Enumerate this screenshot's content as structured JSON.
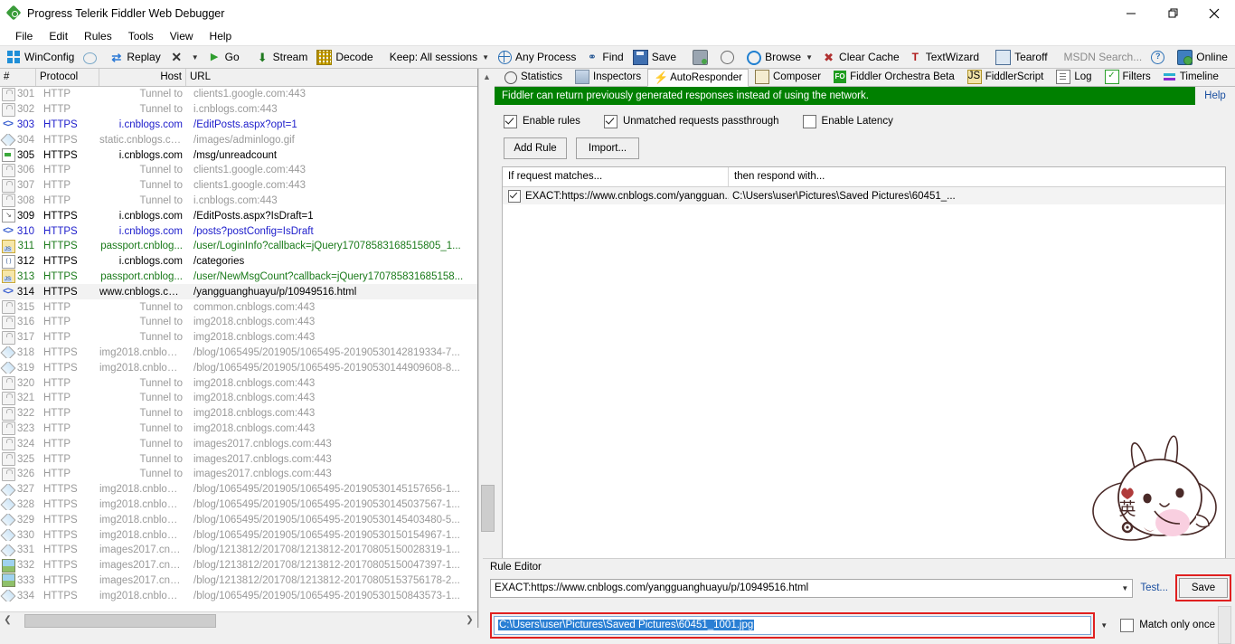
{
  "window": {
    "title": "Progress Telerik Fiddler Web Debugger",
    "minimize": "─",
    "maximize": "❐",
    "close": "✕"
  },
  "menu": [
    "File",
    "Edit",
    "Rules",
    "Tools",
    "View",
    "Help"
  ],
  "toolbar": [
    {
      "label": "WinConfig",
      "icon": "windows-icon"
    },
    {
      "label": "",
      "icon": "comment-bubble-icon"
    },
    {
      "label": "Replay",
      "icon": "replay-icon"
    },
    {
      "label": "",
      "icon": "remove-x-icon",
      "caret": true
    },
    {
      "label": "Go",
      "icon": "go-play-icon"
    },
    {
      "label": "Stream",
      "icon": "stream-icon"
    },
    {
      "label": "Decode",
      "icon": "decode-icon"
    },
    {
      "label": "Keep: All sessions",
      "icon": "",
      "caret": true
    },
    {
      "label": "Any Process",
      "icon": "target-icon"
    },
    {
      "label": "Find",
      "icon": "binoculars-icon"
    },
    {
      "label": "Save",
      "icon": "save-icon"
    },
    {
      "label": "",
      "icon": "screenshot-camera-icon"
    },
    {
      "label": "",
      "icon": "timer-clock-icon"
    },
    {
      "label": "Browse",
      "icon": "browser-icon",
      "caret": true
    },
    {
      "label": "Clear Cache",
      "icon": "clear-cache-icon"
    },
    {
      "label": "TextWizard",
      "icon": "textwizard-icon"
    },
    {
      "label": "Tearoff",
      "icon": "tearoff-icon"
    },
    {
      "label": "MSDN Search...",
      "icon": "",
      "dim": true
    },
    {
      "label": "",
      "icon": "help-circle-icon"
    },
    {
      "label": "Online",
      "icon": "online-globe-icon"
    }
  ],
  "toolbar_close": "✕",
  "sessions": {
    "columns": [
      "#",
      "Protocol",
      "Host",
      "URL"
    ],
    "rows": [
      {
        "icon": "lock-icon",
        "num": "301",
        "protocol": "HTTP",
        "host": "Tunnel to",
        "url": "clients1.google.com:443",
        "style": "gray"
      },
      {
        "icon": "lock-icon",
        "num": "302",
        "protocol": "HTTP",
        "host": "Tunnel to",
        "url": "i.cnblogs.com:443",
        "style": "gray"
      },
      {
        "icon": "code-icon",
        "num": "303",
        "protocol": "HTTPS",
        "host": "i.cnblogs.com",
        "url": "/EditPosts.aspx?opt=1",
        "style": "blue"
      },
      {
        "icon": "image-icon",
        "num": "304",
        "protocol": "HTTPS",
        "host": "static.cnblogs.com",
        "url": "/images/adminlogo.gif",
        "style": "gray"
      },
      {
        "icon": "arrow-icon",
        "num": "305",
        "protocol": "HTTPS",
        "host": "i.cnblogs.com",
        "url": "/msg/unreadcount",
        "style": "black"
      },
      {
        "icon": "lock-icon",
        "num": "306",
        "protocol": "HTTP",
        "host": "Tunnel to",
        "url": "clients1.google.com:443",
        "style": "gray"
      },
      {
        "icon": "lock-icon",
        "num": "307",
        "protocol": "HTTP",
        "host": "Tunnel to",
        "url": "clients1.google.com:443",
        "style": "gray"
      },
      {
        "icon": "lock-icon",
        "num": "308",
        "protocol": "HTTP",
        "host": "Tunnel to",
        "url": "i.cnblogs.com:443",
        "style": "gray"
      },
      {
        "icon": "download-icon",
        "num": "309",
        "protocol": "HTTPS",
        "host": "i.cnblogs.com",
        "url": "/EditPosts.aspx?IsDraft=1",
        "style": "black"
      },
      {
        "icon": "code-icon",
        "num": "310",
        "protocol": "HTTPS",
        "host": "i.cnblogs.com",
        "url": "/posts?postConfig=IsDraft",
        "style": "blue"
      },
      {
        "icon": "js-icon",
        "num": "311",
        "protocol": "HTTPS",
        "host": "passport.cnblog...",
        "url": "/user/LoginInfo?callback=jQuery17078583168515805_1...",
        "style": "green"
      },
      {
        "icon": "json-icon",
        "num": "312",
        "protocol": "HTTPS",
        "host": "i.cnblogs.com",
        "url": "/categories",
        "style": "black"
      },
      {
        "icon": "js-icon",
        "num": "313",
        "protocol": "HTTPS",
        "host": "passport.cnblog...",
        "url": "/user/NewMsgCount?callback=jQuery170785831685158...",
        "style": "green"
      },
      {
        "icon": "code-icon",
        "num": "314",
        "protocol": "HTTPS",
        "host": "www.cnblogs.com",
        "url": "/yangguanghuayu/p/10949516.html",
        "style": "black",
        "selected": true
      },
      {
        "icon": "lock-icon",
        "num": "315",
        "protocol": "HTTP",
        "host": "Tunnel to",
        "url": "common.cnblogs.com:443",
        "style": "gray"
      },
      {
        "icon": "lock-icon",
        "num": "316",
        "protocol": "HTTP",
        "host": "Tunnel to",
        "url": "img2018.cnblogs.com:443",
        "style": "gray"
      },
      {
        "icon": "lock-icon",
        "num": "317",
        "protocol": "HTTP",
        "host": "Tunnel to",
        "url": "img2018.cnblogs.com:443",
        "style": "gray"
      },
      {
        "icon": "image-icon",
        "num": "318",
        "protocol": "HTTPS",
        "host": "img2018.cnblogs...",
        "url": "/blog/1065495/201905/1065495-20190530142819334-7...",
        "style": "gray"
      },
      {
        "icon": "image-icon",
        "num": "319",
        "protocol": "HTTPS",
        "host": "img2018.cnblogs...",
        "url": "/blog/1065495/201905/1065495-20190530144909608-8...",
        "style": "gray"
      },
      {
        "icon": "lock-icon",
        "num": "320",
        "protocol": "HTTP",
        "host": "Tunnel to",
        "url": "img2018.cnblogs.com:443",
        "style": "gray"
      },
      {
        "icon": "lock-icon",
        "num": "321",
        "protocol": "HTTP",
        "host": "Tunnel to",
        "url": "img2018.cnblogs.com:443",
        "style": "gray"
      },
      {
        "icon": "lock-icon",
        "num": "322",
        "protocol": "HTTP",
        "host": "Tunnel to",
        "url": "img2018.cnblogs.com:443",
        "style": "gray"
      },
      {
        "icon": "lock-icon",
        "num": "323",
        "protocol": "HTTP",
        "host": "Tunnel to",
        "url": "img2018.cnblogs.com:443",
        "style": "gray"
      },
      {
        "icon": "lock-icon",
        "num": "324",
        "protocol": "HTTP",
        "host": "Tunnel to",
        "url": "images2017.cnblogs.com:443",
        "style": "gray"
      },
      {
        "icon": "lock-icon",
        "num": "325",
        "protocol": "HTTP",
        "host": "Tunnel to",
        "url": "images2017.cnblogs.com:443",
        "style": "gray"
      },
      {
        "icon": "lock-icon",
        "num": "326",
        "protocol": "HTTP",
        "host": "Tunnel to",
        "url": "images2017.cnblogs.com:443",
        "style": "gray"
      },
      {
        "icon": "image-icon",
        "num": "327",
        "protocol": "HTTPS",
        "host": "img2018.cnblogs...",
        "url": "/blog/1065495/201905/1065495-20190530145157656-1...",
        "style": "gray"
      },
      {
        "icon": "image-icon",
        "num": "328",
        "protocol": "HTTPS",
        "host": "img2018.cnblogs...",
        "url": "/blog/1065495/201905/1065495-20190530145037567-1...",
        "style": "gray"
      },
      {
        "icon": "image-icon",
        "num": "329",
        "protocol": "HTTPS",
        "host": "img2018.cnblogs...",
        "url": "/blog/1065495/201905/1065495-20190530145403480-5...",
        "style": "gray"
      },
      {
        "icon": "image-icon",
        "num": "330",
        "protocol": "HTTPS",
        "host": "img2018.cnblogs...",
        "url": "/blog/1065495/201905/1065495-20190530150154967-1...",
        "style": "gray"
      },
      {
        "icon": "image-icon",
        "num": "331",
        "protocol": "HTTPS",
        "host": "images2017.cnbl...",
        "url": "/blog/1213812/201708/1213812-20170805150028319-1...",
        "style": "gray"
      },
      {
        "icon": "picture-icon",
        "num": "332",
        "protocol": "HTTPS",
        "host": "images2017.cnbl...",
        "url": "/blog/1213812/201708/1213812-20170805150047397-1...",
        "style": "gray"
      },
      {
        "icon": "picture-icon",
        "num": "333",
        "protocol": "HTTPS",
        "host": "images2017.cnbl...",
        "url": "/blog/1213812/201708/1213812-20170805153756178-2...",
        "style": "gray"
      },
      {
        "icon": "image-icon",
        "num": "334",
        "protocol": "HTTPS",
        "host": "img2018.cnblogs...",
        "url": "/blog/1065495/201905/1065495-20190530150843573-1...",
        "style": "gray"
      }
    ]
  },
  "tabs": [
    {
      "label": "Statistics",
      "icon": "statistics-icon",
      "active": false
    },
    {
      "label": "Inspectors",
      "icon": "inspectors-icon",
      "active": false
    },
    {
      "label": "AutoResponder",
      "icon": "autoresponder-bolt-icon",
      "active": true
    },
    {
      "label": "Composer",
      "icon": "composer-icon",
      "active": false
    },
    {
      "label": "Fiddler Orchestra Beta",
      "icon": "fiddler-orchestra-icon",
      "active": false
    },
    {
      "label": "FiddlerScript",
      "icon": "fiddlerscript-icon",
      "active": false
    },
    {
      "label": "Log",
      "icon": "log-icon",
      "active": false
    },
    {
      "label": "Filters",
      "icon": "filters-icon",
      "active": false
    },
    {
      "label": "Timeline",
      "icon": "timeline-icon",
      "active": false
    }
  ],
  "banner": {
    "text": "Fiddler can return previously generated responses instead of using the network.",
    "help": "Help",
    "color": "#008000"
  },
  "options": [
    {
      "label": "Enable rules",
      "checked": true
    },
    {
      "label": "Unmatched requests passthrough",
      "checked": true
    },
    {
      "label": "Enable Latency",
      "checked": false
    }
  ],
  "buttons": {
    "add_rule": "Add Rule",
    "import": "Import..."
  },
  "rules_grid": {
    "col_match": "If request matches...",
    "col_respond": "then respond with...",
    "rows": [
      {
        "checked": true,
        "match": "EXACT:https://www.cnblogs.com/yangguan...",
        "respond": "C:\\Users\\user\\Pictures\\Saved Pictures\\60451_..."
      }
    ]
  },
  "rule_editor": {
    "label": "Rule Editor",
    "match_value": "EXACT:https://www.cnblogs.com/yangguanghuayu/p/10949516.html",
    "respond_value": "C:\\Users\\user\\Pictures\\Saved Pictures\\60451_1001.jpg",
    "test_link": "Test...",
    "save_button": "Save",
    "match_only_once": "Match only once",
    "match_only_once_checked": false,
    "highlight_color": "#e02020"
  },
  "mascot": {
    "name": "rabbit-ime-mascot",
    "char": "英"
  }
}
